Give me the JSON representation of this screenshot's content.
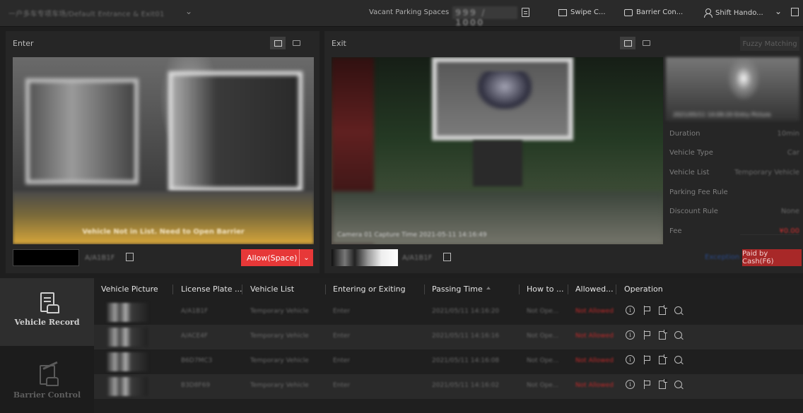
{
  "topbar": {
    "entrance": "一户多车专项车场/Default Entrance & Exit01",
    "vacant_label": "Vacant Parking Spaces",
    "vacant_value": "999 / 1000",
    "swipe": "Swipe C...",
    "barrier": "Barrier Con...",
    "shift": "Shift Hando..."
  },
  "enter": {
    "title": "Enter",
    "notice": "Vehicle Not in List. Need to Open Barrier",
    "plate": "A/A1B1F",
    "allow_label": "Allow(Space)"
  },
  "exit": {
    "title": "Exit",
    "caption": "Camera 01  Capture Time 2021-05-11 14:16:49",
    "plate": "A/A1B1F",
    "fuzzy": "Fuzzy Matching",
    "thumb_caption": "2021/05/11 14:09:20 Entry Picture",
    "info": [
      {
        "label": "Duration",
        "value": "10min"
      },
      {
        "label": "Vehicle Type",
        "value": "Car"
      },
      {
        "label": "Vehicle List",
        "value": "Temporary Vehicle"
      },
      {
        "label": "Parking Fee Rule",
        "value": ""
      },
      {
        "label": "Discount Rule",
        "value": "None"
      },
      {
        "label": "Fee",
        "value": "¥0.00"
      }
    ],
    "exception_link": "Exception",
    "paid_label": "Paid by Cash(F6)"
  },
  "nav": {
    "record": "Vehicle Record",
    "barrier": "Barrier Control"
  },
  "table": {
    "columns": [
      "Vehicle Picture",
      "License Plate ...",
      "Vehicle List",
      "Entering or Exiting",
      "Passing Time",
      "How to ...",
      "Allowed...",
      "Operation"
    ],
    "rows": [
      {
        "plate": "A/A1B1F",
        "list": "Temporary Vehicle",
        "dir": "Enter",
        "time": "2021/05/11 14:16:20",
        "how": "Not Ope...",
        "allowed": "Not Allowed"
      },
      {
        "plate": "A/ACE4F",
        "list": "Temporary Vehicle",
        "dir": "Enter",
        "time": "2021/05/11 14:16:16",
        "how": "Not Ope...",
        "allowed": "Not Allowed"
      },
      {
        "plate": "B6D7MC3",
        "list": "Temporary Vehicle",
        "dir": "Enter",
        "time": "2021/05/11 14:16:08",
        "how": "Not Ope...",
        "allowed": "Not Allowed"
      },
      {
        "plate": "B3D8F69",
        "list": "Temporary Vehicle",
        "dir": "Enter",
        "time": "2021/05/11 14:16:02",
        "how": "Not Ope...",
        "allowed": "Not Allowed"
      }
    ]
  },
  "colors": {
    "accent": "#e73838",
    "paid": "#a82828",
    "not_allowed": "#c22a2a",
    "background": "#1e1e1e"
  },
  "icons": [
    "chevron-down-icon",
    "document-icon",
    "card-icon",
    "barrier-icon",
    "person-icon",
    "edit-icon",
    "image-mode-icon",
    "video-mode-icon",
    "vehicle-record-icon",
    "barrier-control-icon",
    "info-icon",
    "flag-icon",
    "export-icon",
    "search-icon",
    "sort-icon"
  ]
}
